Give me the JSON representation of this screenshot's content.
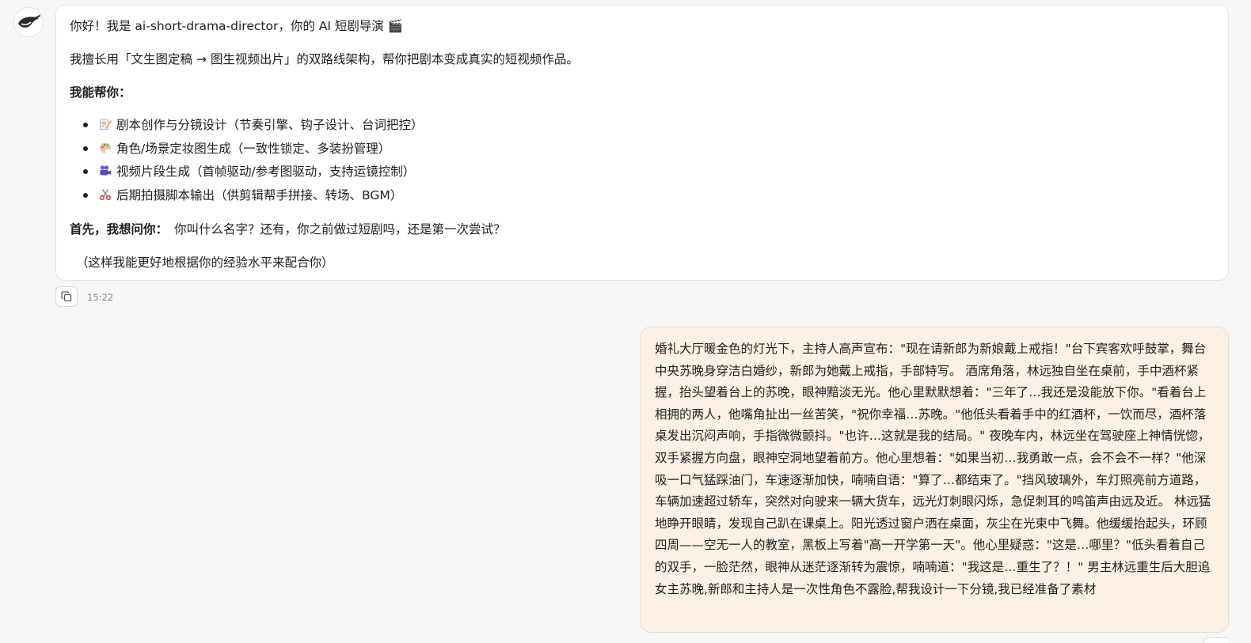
{
  "assistant_message": {
    "greeting": "你好！我是 ai-short-drama-director，你的 AI 短剧导演 🎬",
    "intro": "我擅长用「文生图定稿 → 图生视频出片」的双路线架构，帮你把剧本变成真实的短视频作品。",
    "help_title": "我能帮你：",
    "capabilities": [
      {
        "icon": "memo-icon",
        "label": "剧本创作与分镜设计（节奏引擎、钩子设计、台词把控）"
      },
      {
        "icon": "palette-icon",
        "label": "角色/场景定妆图生成（一致性锁定、多装扮管理）"
      },
      {
        "icon": "movie-camera-icon",
        "label": "视频片段生成（首帧驱动/参考图驱动，支持运镜控制）"
      },
      {
        "icon": "scissors-icon",
        "label": "后期拍摄脚本输出（供剪辑帮手拼接、转场、BGM）"
      }
    ],
    "question_label": "首先，我想问你：",
    "question_text": "你叫什么名字？还有，你之前做过短剧吗，还是第一次尝试？",
    "note": "（这样我能更好地根据你的经验水平来配合你）"
  },
  "meta": {
    "timestamp": "15:22"
  },
  "user_message": {
    "text": "婚礼大厅暖金色的灯光下，主持人高声宣布：\"现在请新郎为新娘戴上戒指！\"台下宾客欢呼鼓掌，舞台中央苏晚身穿洁白婚纱，新郎为她戴上戒指，手部特写。 酒席角落，林远独自坐在桌前，手中酒杯紧握，抬头望着台上的苏晚，眼神黯淡无光。他心里默默想着：\"三年了…我还是没能放下你。\"看着台上相拥的两人，他嘴角扯出一丝苦笑，\"祝你幸福…苏晚。\"他低头看着手中的红酒杯，一饮而尽，酒杯落桌发出沉闷声响，手指微微颤抖。\"也许…这就是我的结局。\" 夜晚车内，林远坐在驾驶座上神情恍惚，双手紧握方向盘，眼神空洞地望着前方。他心里想着：\"如果当初…我勇敢一点，会不会不一样？\"他深吸一口气猛踩油门，车速逐渐加快，喃喃自语：\"算了…都结束了。\"挡风玻璃外，车灯照亮前方道路，车辆加速超过轿车，突然对向驶来一辆大货车，远光灯刺眼闪烁，急促刺耳的鸣笛声由远及近。 林远猛地睁开眼睛，发现自己趴在课桌上。阳光透过窗户洒在桌面，灰尘在光束中飞舞。他缓缓抬起头，环顾四周——空无一人的教室，黑板上写着\"高一开学第一天\"。他心里疑惑：\"这是…哪里？\"低头看着自己的双手，一脸茫然，眼神从迷茫逐渐转为震惊，喃喃道：\"我这是…重生了？！\" 男主林远重生后大胆追女主苏晚,新郎和主持人是一次性角色不露脸,帮我设计一下分镜,我已经准备了素材"
  }
}
